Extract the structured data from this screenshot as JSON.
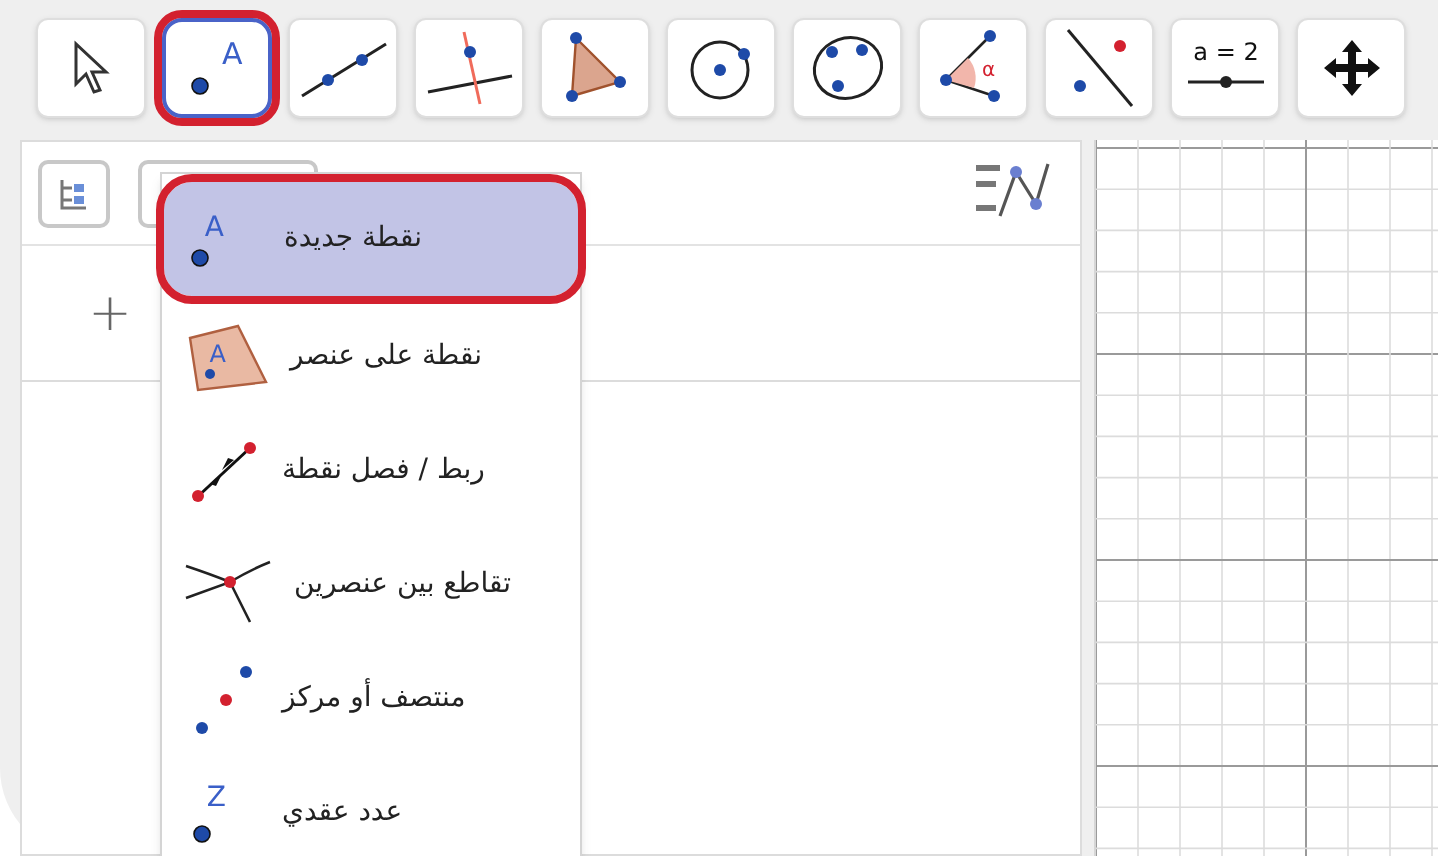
{
  "toolbar": [
    {
      "kind": "move",
      "selected": false
    },
    {
      "kind": "point",
      "icon_label": "A",
      "selected": true
    },
    {
      "kind": "line",
      "selected": false
    },
    {
      "kind": "perpendicular",
      "selected": false
    },
    {
      "kind": "polygon",
      "selected": false
    },
    {
      "kind": "circle",
      "selected": false
    },
    {
      "kind": "conic",
      "selected": false
    },
    {
      "kind": "angle",
      "icon_label": "α",
      "selected": false
    },
    {
      "kind": "reflect",
      "selected": false
    },
    {
      "kind": "slider",
      "icon_label": "a = 2",
      "selected": false
    },
    {
      "kind": "pan",
      "selected": false
    }
  ],
  "algebra_panel": {
    "input_button": "+"
  },
  "point_menu": [
    {
      "kind": "point",
      "label": "نقطة جديدة",
      "icon_label": "A",
      "selected": true
    },
    {
      "kind": "point-on-object",
      "label": "نقطة على عنصر",
      "icon_label": "A",
      "selected": false
    },
    {
      "kind": "attach",
      "label": "ربط / فصل نقطة",
      "selected": false
    },
    {
      "kind": "intersect",
      "label": "تقاطع بين عنصرين",
      "selected": false
    },
    {
      "kind": "midpoint",
      "label": "منتصف أو مركز",
      "selected": false
    },
    {
      "kind": "complex",
      "label": "عدد عقدي",
      "icon_label": "Z",
      "selected": false
    }
  ]
}
